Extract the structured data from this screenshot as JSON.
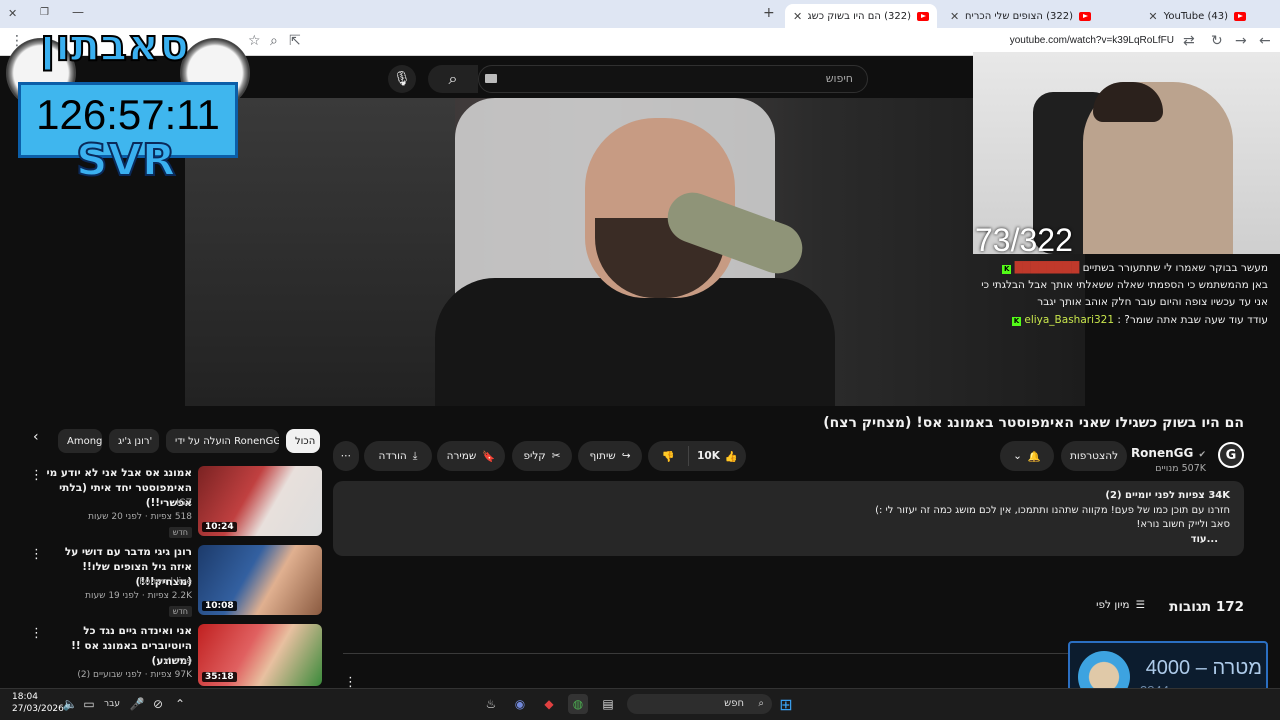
{
  "browser": {
    "tabs": [
      {
        "title": "(322) הם היו בשוק כשגילו שאני",
        "active": true
      },
      {
        "title": "(322) הצופים שלי הכריחו אותי",
        "active": false
      },
      {
        "title": "(43) YouTube",
        "active": false
      }
    ],
    "url": "youtube.com/watch?v=k39LqRoLfFU"
  },
  "youtube": {
    "search_placeholder": "חיפוש",
    "video_title": "הם היו בשוק כשגילו שאני האימפוסטר באמונג אס! (מצחיק רצח)",
    "channel_name": "RonenGG",
    "channel_subs": "507K מנויים",
    "channel_avatar_letter": "G",
    "subscribe_label": "להצטרפות",
    "like_count": "10K",
    "share_label": "שיתוף",
    "clip_label": "קליפ",
    "save_label": "שמירה",
    "download_label": "הורדה",
    "description": {
      "meta": "34K צפיות  לפני יומיים (2)",
      "line1": "חזרנו עם תוכן כמו של פעם! מקווה שתהנו ותתמכו, אין לכם מושג כמה זה יעזור לי :)",
      "line2": "סאב ולייק חשוב נורא!",
      "more": "...עוד"
    },
    "comments_count": "172 תגובות",
    "sort_label": "מיון לפי",
    "chips": [
      "הכול",
      "הועלה על ידי RonenGG",
      "רונן ג'יג'",
      "Among Us"
    ],
    "recommendations": [
      {
        "title": "אמונג אס אבל אני לא יודע מי האימפוסטר יחד איתי (בלתי אפשרי!!)",
        "channel": "IGZ",
        "meta": "518 צפיות · לפני 20 שעות",
        "badge": "חדש",
        "duration": "10:24"
      },
      {
        "title": "רונן גיגי מדבר עם דושי על איזה גיל הצופים שלו!! (מצחיק!!!)",
        "channel": "Ronen | live",
        "meta": "2.2K צפיות · לפני 19 שעות",
        "badge": "חדש",
        "duration": "10:08"
      },
      {
        "title": "אני ואינדה גיים נגד כל היוטיוברים באמונג אס !! (משוגע)",
        "channel": "פריזי",
        "meta": "97K צפיות · לפני שבועיים (2)",
        "badge": "",
        "duration": "35:18"
      }
    ]
  },
  "stream_overlay": {
    "logo_text": "סאבתון",
    "timer": "126:57:11",
    "sub_label": "SVR",
    "counter": "73/322",
    "chat": [
      {
        "user": "",
        "message": "מעשר בבוקר שאמרו לי שתתעורר בשתיים",
        "name_color": "red"
      },
      {
        "user": "",
        "message": "באן מהמשתמש כי הספמתי שאלה ששאלתי אותך אבל הבלגתי כי",
        "name_color": ""
      },
      {
        "user": "",
        "message": "אני עד עכשיו צופה והיום עובר חלק אוהב אותך יגבר",
        "name_color": ""
      },
      {
        "user": "eliya_Bashari321",
        "message": "עודד עוד שעה שבת אתה שומר?",
        "name_color": "green"
      }
    ],
    "goal_label": "מטרה",
    "goal_target": "4000",
    "goal_current": "3844"
  },
  "taskbar": {
    "time": "18:04",
    "date": "27/03/2026",
    "language": "עבר",
    "search_label": "חפש"
  },
  "colors": {
    "accent_red": "#ff0000",
    "bg_dark": "#0f0f0f",
    "kick_green": "#53fc18",
    "timer_blue": "#3fb6ee"
  }
}
